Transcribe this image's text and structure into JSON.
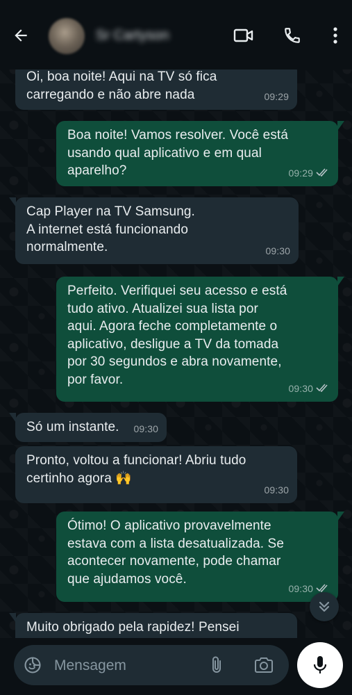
{
  "header": {
    "contact_name": "Sr Cartyson",
    "icons": {
      "back": "arrow-left-icon",
      "video": "video-camera-icon",
      "call": "phone-icon",
      "menu": "more-vertical-icon"
    }
  },
  "messages": [
    {
      "direction": "in",
      "text": "Oi, boa noite! Aqui na TV só fica\ncarregando e não abre nada",
      "time": "09:29"
    },
    {
      "direction": "out",
      "text": "Boa noite! Vamos resolver. Você está\nusando qual aplicativo e em qual\naparelho?",
      "time": "09:29",
      "status": "read"
    },
    {
      "direction": "in",
      "text": "Cap Player na TV Samsung.\nA internet está funcionando\nnormalmente.",
      "time": "09:30"
    },
    {
      "direction": "out",
      "text": "Perfeito. Verifiquei seu acesso e está\ntudo ativo. Atualizei sua lista por\naqui. Agora feche completamente o\naplicativo, desligue a TV da tomada\npor 30 segundos e abra novamente,\npor favor.",
      "time": "09:30",
      "status": "read"
    },
    {
      "direction": "in",
      "text": "Só um instante.",
      "time": "09:30"
    },
    {
      "direction": "in",
      "text": "Pronto, voltou a funcionar! Abriu tudo\ncertinho agora 🙌",
      "time": "09:30"
    },
    {
      "direction": "out",
      "text": "Ótimo! O aplicativo provavelmente\nestava com a lista desatualizada. Se\nacontecer novamente, pode chamar\nque ajudamos você.",
      "time": "09:30",
      "status": "read"
    },
    {
      "direction": "in",
      "text": "Muito obrigado pela rapidez! Pensei",
      "time": ""
    }
  ],
  "composer": {
    "placeholder": "Mensagem",
    "icons": {
      "emoji": "sticker-emoji-icon",
      "attach": "paperclip-icon",
      "camera": "camera-icon",
      "mic": "microphone-icon",
      "scroll_down": "double-chevron-down-icon"
    }
  },
  "colors": {
    "background": "#0b1014",
    "incoming_bubble": "#1f2c34",
    "outgoing_bubble": "#0f4e3b",
    "text": "#e9edef",
    "meta_text": "#8696a0"
  }
}
